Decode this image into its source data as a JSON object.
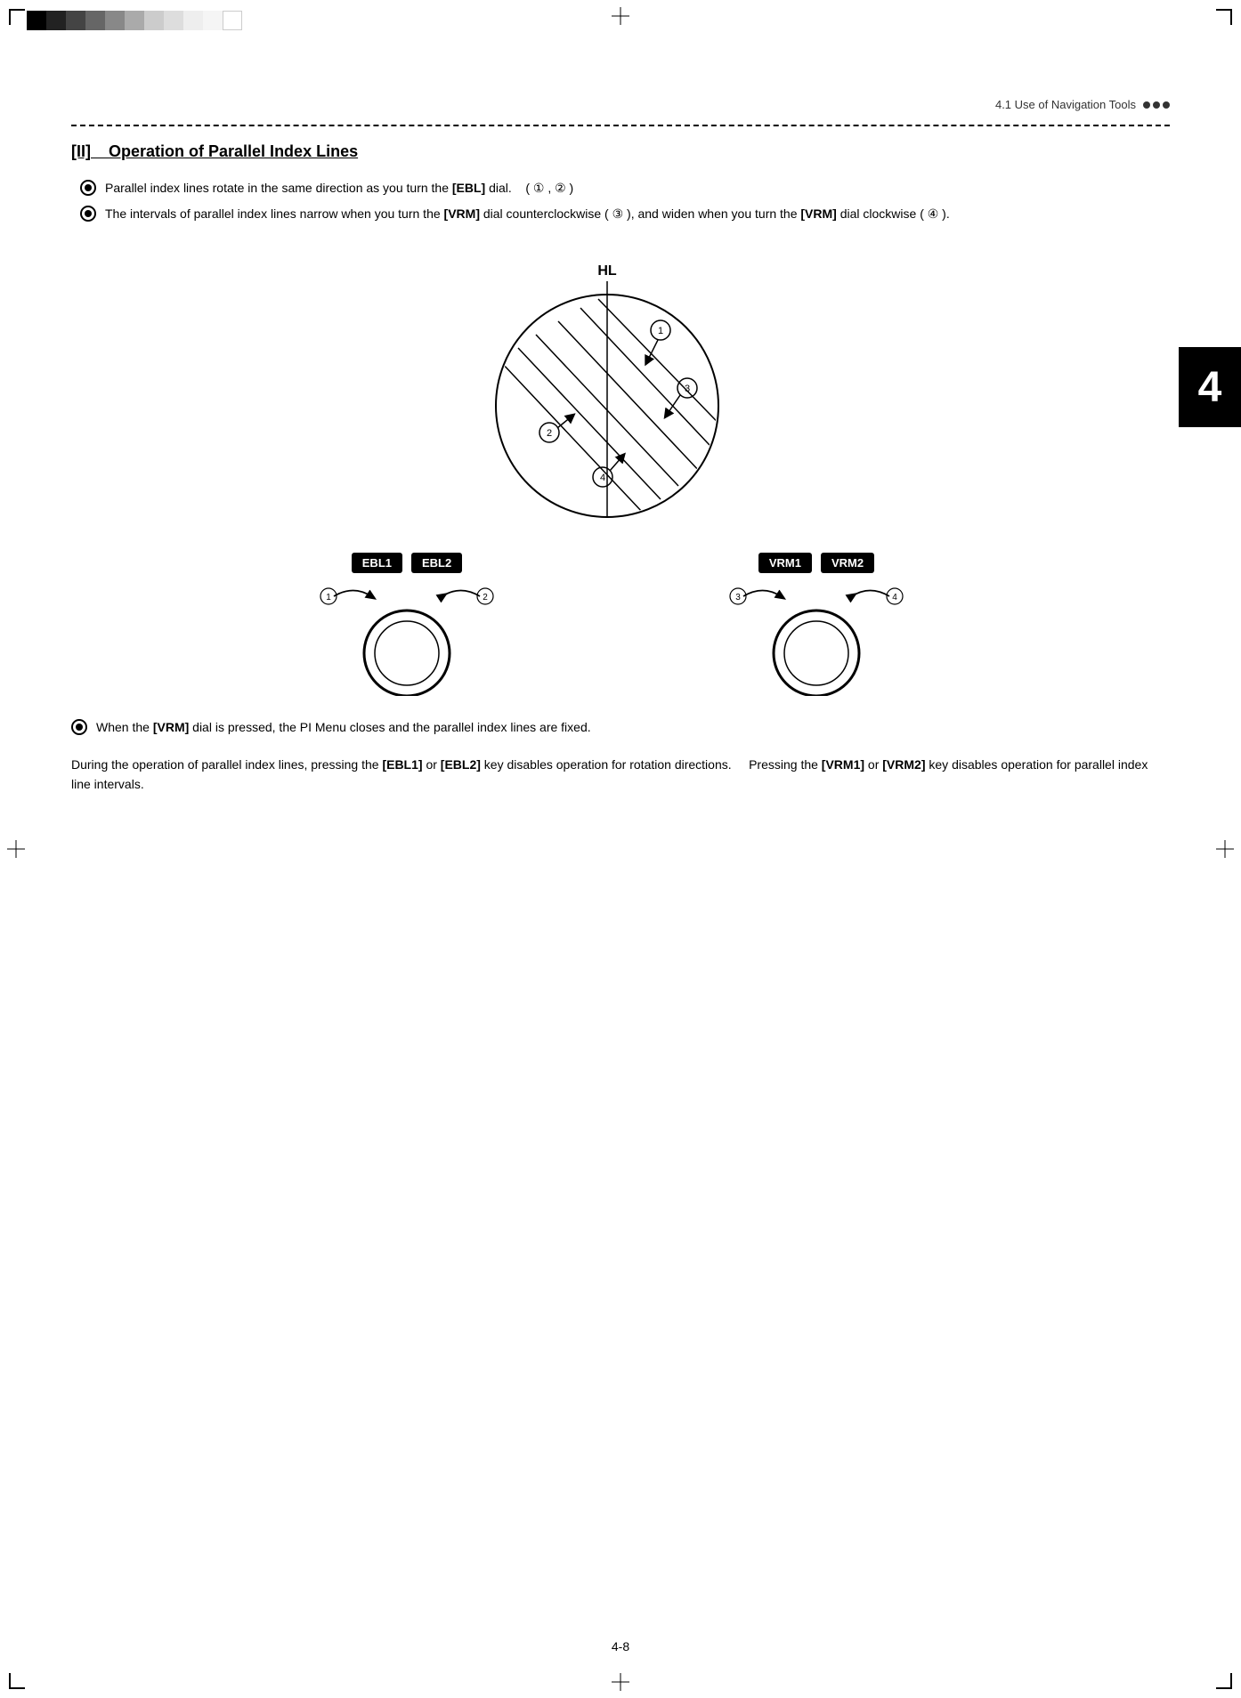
{
  "page": {
    "number": "4-8",
    "chapter_num": "4"
  },
  "header": {
    "section_ref": "4.1  Use of Navigation Tools"
  },
  "section": {
    "title_bracket": "[II]",
    "title_text": "Operation of Parallel Index Lines"
  },
  "bullets": [
    {
      "text_parts": [
        "Parallel index lines rotate in the same direction as you turn the ",
        "[EBL]",
        " dial.   ( ",
        "①",
        " , ",
        "②",
        " )"
      ]
    },
    {
      "text_parts": [
        "The intervals of parallel index lines narrow when you turn the ",
        "[VRM]",
        " dial counterclockwise ( ",
        "③",
        " ), and widen when you turn the ",
        "[VRM]",
        " dial clockwise ( ",
        "④",
        " )."
      ]
    }
  ],
  "diagram": {
    "hl_label": "HL",
    "numbers": [
      "①",
      "②",
      "③",
      "④"
    ]
  },
  "knobs": {
    "left_group": {
      "labels": [
        "EBL1",
        "EBL2"
      ],
      "num_left": "①",
      "num_right": "②"
    },
    "right_group": {
      "labels": [
        "VRM1",
        "VRM2"
      ],
      "num_left": "③",
      "num_right": "④"
    }
  },
  "note_bullet": {
    "text_parts": [
      "When the ",
      "[VRM]",
      " dial is pressed, the PI Menu closes and the parallel index lines are fixed."
    ]
  },
  "bottom_paragraph": {
    "text": "During the operation of parallel index lines, pressing the [EBL1] or [EBL2] key disables operation for rotation directions.    Pressing the [VRM1] or [VRM2] key disables operation for parallel index line intervals."
  },
  "grayscale_colors": [
    "#000",
    "#222",
    "#444",
    "#666",
    "#888",
    "#aaa",
    "#ccc",
    "#ddd",
    "#eee",
    "#f5f5f5",
    "#fff"
  ]
}
